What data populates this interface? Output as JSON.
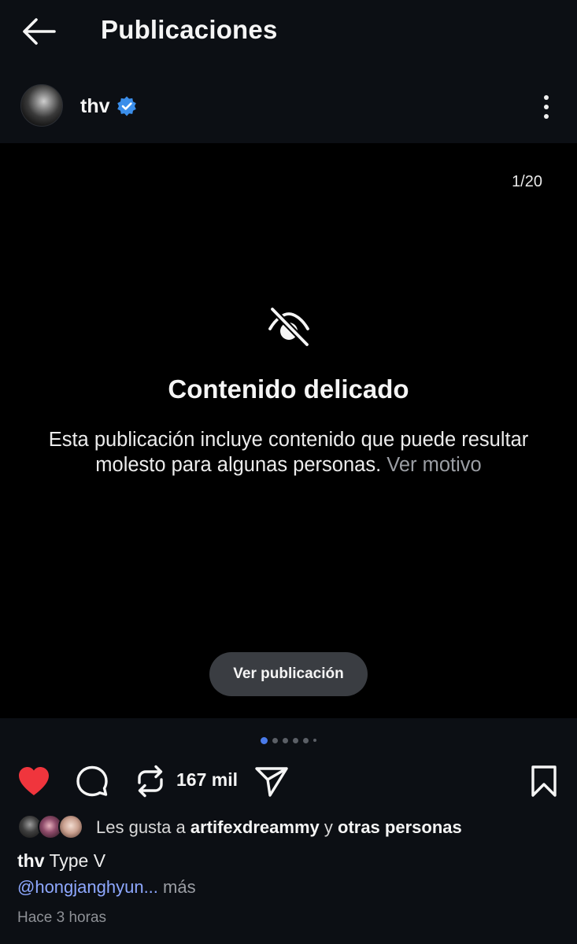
{
  "header": {
    "title": "Publicaciones",
    "back_icon": "arrow-left-icon"
  },
  "post": {
    "username": "thv",
    "verified": true,
    "verified_color": "#3b8eea",
    "media_counter": "1/20",
    "sensitive": {
      "title": "Contenido delicado",
      "description": "Esta publicación incluye contenido que puede resultar molesto para algunas personas.",
      "see_reason_link": "Ver motivo",
      "see_post_button": "Ver publicación"
    },
    "carousel_dots": 6,
    "carousel_active_index": 0
  },
  "actions": {
    "like_icon": "heart-filled-icon",
    "like_color": "#f0353d",
    "comment_icon": "comment-bubble-icon",
    "repost_icon": "repost-icon",
    "repost_count": "167 mil",
    "share_icon": "send-icon",
    "save_icon": "bookmark-icon"
  },
  "likes": {
    "prefix": "Les gusta a",
    "user": "artifexdreammy",
    "connector": "y",
    "others": "otras personas"
  },
  "caption": {
    "username": "thv",
    "text": "Type V",
    "mention": "@hongjanghyun...",
    "more": "más"
  },
  "timestamp": "Hace 3 horas"
}
